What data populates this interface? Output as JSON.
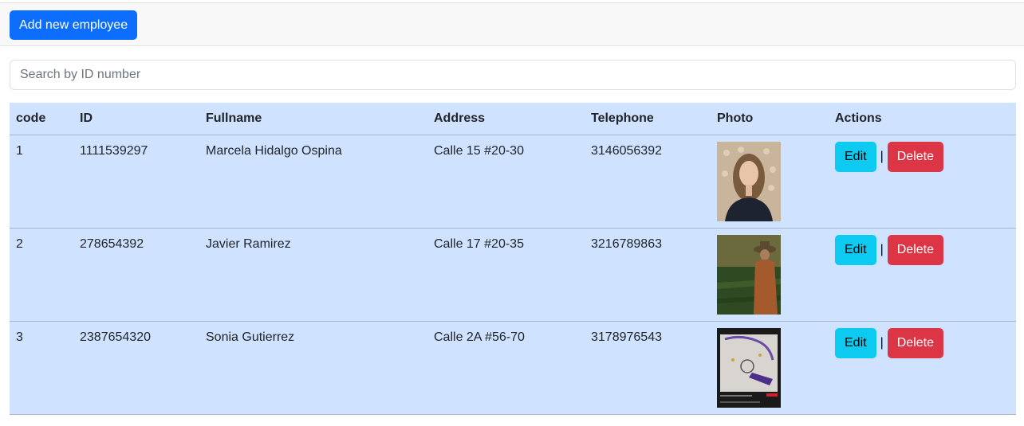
{
  "toolbar": {
    "add_label": "Add new employee"
  },
  "search": {
    "placeholder": "Search by ID number",
    "value": ""
  },
  "table": {
    "headers": [
      "code",
      "ID",
      "Fullname",
      "Address",
      "Telephone",
      "Photo",
      "Actions"
    ],
    "rows": [
      {
        "code": "1",
        "id": "1111539297",
        "fullname": "Marcela Hidalgo Ospina",
        "address": "Calle 15 #20-30",
        "telephone": "3146056392"
      },
      {
        "code": "2",
        "id": "278654392",
        "fullname": "Javier Ramirez",
        "address": "Calle 17 #20-35",
        "telephone": "3216789863"
      },
      {
        "code": "3",
        "id": "2387654320",
        "fullname": "Sonia Gutierrez",
        "address": "Calle 2A #56-70",
        "telephone": "3178976543"
      }
    ],
    "actions": {
      "edit_label": "Edit",
      "separator": "|",
      "delete_label": "Delete"
    }
  },
  "colors": {
    "primary": "#0d6efd",
    "info": "#0dcaf0",
    "danger": "#dc3545",
    "table_bg": "#cfe2ff"
  }
}
